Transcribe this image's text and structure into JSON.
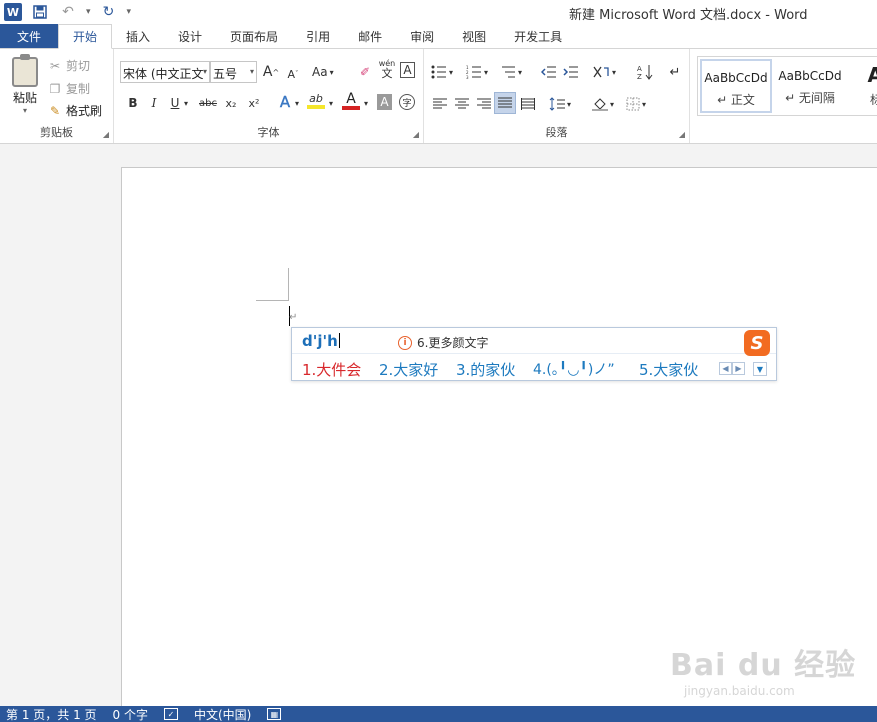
{
  "title_bar": {
    "app_icon": "W",
    "window_title": "新建 Microsoft Word 文档.docx - Word"
  },
  "tabs": [
    {
      "label": "文件"
    },
    {
      "label": "开始"
    },
    {
      "label": "插入"
    },
    {
      "label": "设计"
    },
    {
      "label": "页面布局"
    },
    {
      "label": "引用"
    },
    {
      "label": "邮件"
    },
    {
      "label": "审阅"
    },
    {
      "label": "视图"
    },
    {
      "label": "开发工具"
    }
  ],
  "ribbon": {
    "clipboard": {
      "group_label": "剪贴板",
      "paste": "粘贴",
      "cut": "剪切",
      "copy": "复制",
      "format_painter": "格式刷"
    },
    "font": {
      "group_label": "字体",
      "font_name": "宋体 (中文正文",
      "font_size": "五号",
      "grow_icon": "A",
      "shrink_icon": "A",
      "case_label": "Aa",
      "phonetic_top": "wén",
      "phonetic_bottom": "文",
      "border_char": "A",
      "bold": "B",
      "italic": "I",
      "underline": "U",
      "strike": "abc",
      "sub": "x₂",
      "sup": "x²",
      "effects": "A",
      "highlight": "ab",
      "color": "A",
      "shading": "A",
      "enclose": "字"
    },
    "paragraph": {
      "group_label": "段落"
    },
    "styles": [
      {
        "sample": "AaBbCcDd",
        "name": "↵ 正文"
      },
      {
        "sample": "AaBbCcDd",
        "name": "↵ 无间隔"
      },
      {
        "sample": "Aa",
        "name": "标题"
      }
    ]
  },
  "ime": {
    "pinyin": "d'j'h",
    "hint": "6.更多颜文字",
    "logo": "S",
    "candidates": [
      {
        "label": "1.大件会"
      },
      {
        "label": "2.大家好"
      },
      {
        "label": "3.的家伙"
      },
      {
        "label": "4.(｡╹◡╹)ノ”"
      },
      {
        "label": "5.大家伙"
      }
    ]
  },
  "document": {
    "paragraph_mark": "↵"
  },
  "watermark": {
    "main": "Bai du 经验",
    "sub": "jingyan.baidu.com"
  },
  "status_bar": {
    "page": "第 1 页，共 1 页",
    "words": "0 个字",
    "language": "中文(中国)"
  }
}
